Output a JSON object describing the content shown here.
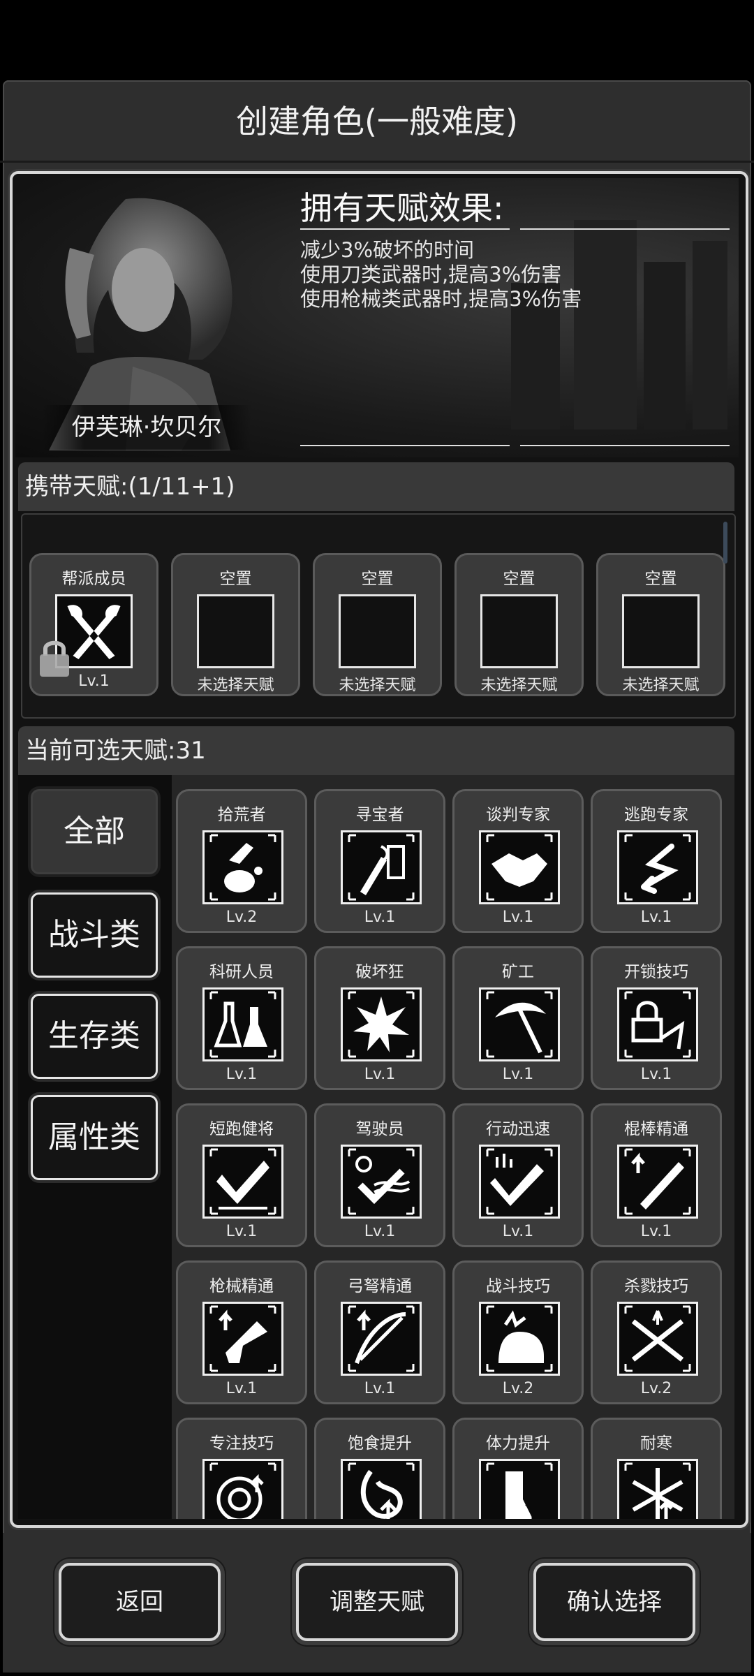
{
  "header": {
    "title": "创建角色(一般难度)"
  },
  "character": {
    "name": "伊芙琳·坎贝尔",
    "effect_title": "拥有天赋效果:",
    "effects": [
      "减少3%破坏的时间",
      "使用刀类武器时,提高3%伤害",
      "使用枪械类武器时,提高3%伤害"
    ]
  },
  "carry": {
    "heading": "携带天赋:(1/11+1)",
    "slots": [
      {
        "name": "帮派成员",
        "level": "Lv.1",
        "icon": "crossed-axes-icon",
        "locked": true
      },
      {
        "name": "空置",
        "level": "未选择天赋"
      },
      {
        "name": "空置",
        "level": "未选择天赋"
      },
      {
        "name": "空置",
        "level": "未选择天赋"
      },
      {
        "name": "空置",
        "level": "未选择天赋"
      }
    ]
  },
  "available": {
    "heading": "当前可选天赋:31",
    "tabs": [
      "全部",
      "战斗类",
      "生存类",
      "属性类"
    ],
    "talents": [
      {
        "name": "拾荒者",
        "level": "Lv.2",
        "icon": "scavenger-icon"
      },
      {
        "name": "寻宝者",
        "level": "Lv.1",
        "icon": "treasure-hunter-icon"
      },
      {
        "name": "谈判专家",
        "level": "Lv.1",
        "icon": "handshake-icon"
      },
      {
        "name": "逃跑专家",
        "level": "Lv.1",
        "icon": "escape-arrow-icon"
      },
      {
        "name": "科研人员",
        "level": "Lv.1",
        "icon": "flask-icon"
      },
      {
        "name": "破坏狂",
        "level": "Lv.1",
        "icon": "explosion-icon"
      },
      {
        "name": "矿工",
        "level": "Lv.1",
        "icon": "pickaxe-icon"
      },
      {
        "name": "开锁技巧",
        "level": "Lv.1",
        "icon": "lockpick-icon"
      },
      {
        "name": "短跑健将",
        "level": "Lv.1",
        "icon": "sprint-icon"
      },
      {
        "name": "驾驶员",
        "level": "Lv.1",
        "icon": "driver-icon"
      },
      {
        "name": "行动迅速",
        "level": "Lv.1",
        "icon": "fast-move-icon"
      },
      {
        "name": "棍棒精通",
        "level": "Lv.1",
        "icon": "bat-icon"
      },
      {
        "name": "枪械精通",
        "level": "Lv.1",
        "icon": "gun-icon"
      },
      {
        "name": "弓弩精通",
        "level": "Lv.1",
        "icon": "crossbow-icon"
      },
      {
        "name": "战斗技巧",
        "level": "Lv.2",
        "icon": "fist-icon"
      },
      {
        "name": "杀戮技巧",
        "level": "Lv.2",
        "icon": "crossed-swords-icon"
      },
      {
        "name": "专注技巧",
        "level": "",
        "icon": "target-icon"
      },
      {
        "name": "饱食提升",
        "level": "",
        "icon": "stomach-icon"
      },
      {
        "name": "体力提升",
        "level": "",
        "icon": "stamina-icon"
      },
      {
        "name": "耐寒",
        "level": "",
        "icon": "snowflake-icon"
      }
    ]
  },
  "buttons": {
    "back": "返回",
    "adjust": "调整天赋",
    "confirm": "确认选择"
  }
}
